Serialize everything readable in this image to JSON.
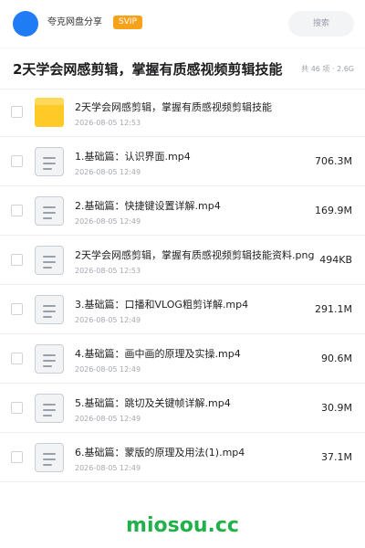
{
  "header": {
    "site_name": "夸克网盘分享",
    "badge": "SVIP",
    "search_placeholder": "搜索"
  },
  "title_bar": {
    "title": "2天学会网感剪辑，掌握有质感视频剪辑技能",
    "item_count": "共 46 项",
    "separator": "·",
    "total_size": "2.6G"
  },
  "files": [
    {
      "type": "folder",
      "name": "2天学会网感剪辑，掌握有质感视频剪辑技能",
      "date": "2026-08-05 12:53",
      "size": ""
    },
    {
      "type": "doc",
      "name": "1.基础篇：认识界面.mp4",
      "date": "2026-08-05 12:49",
      "size": "706.3M"
    },
    {
      "type": "doc",
      "name": "2.基础篇：快捷键设置详解.mp4",
      "date": "2026-08-05 12:49",
      "size": "169.9M"
    },
    {
      "type": "doc",
      "name": "2天学会网感剪辑，掌握有质感视频剪辑技能资料.png",
      "date": "2026-08-05 12:53",
      "size": "494KB"
    },
    {
      "type": "doc",
      "name": "3.基础篇：口播和VLOG粗剪详解.mp4",
      "date": "2026-08-05 12:49",
      "size": "291.1M"
    },
    {
      "type": "doc",
      "name": "4.基础篇：画中画的原理及实操.mp4",
      "date": "2026-08-05 12:49",
      "size": "90.6M"
    },
    {
      "type": "doc",
      "name": "5.基础篇：跳切及关键帧详解.mp4",
      "date": "2026-08-05 12:49",
      "size": "30.9M"
    },
    {
      "type": "doc",
      "name": "6.基础篇：蒙版的原理及用法(1).mp4",
      "date": "2026-08-05 12:49",
      "size": "37.1M"
    }
  ],
  "footer": {
    "watermark": "miosou.cc"
  },
  "colors": {
    "accent": "#1f7cf5",
    "badge": "#f7a21b",
    "folder": "#ffc928",
    "watermark": "#21b04a"
  },
  "icons": {
    "folder": "folder-icon",
    "doc": "file-icon"
  }
}
